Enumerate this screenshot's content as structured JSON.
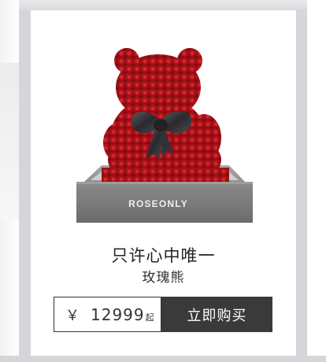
{
  "product": {
    "name": "只许心中唯一",
    "subtitle": "玫瑰熊",
    "box_brand": "ROSEONLY",
    "image_icon": "rose-bear-image"
  },
  "price": {
    "currency": "￥",
    "amount": "12999",
    "suffix": "起"
  },
  "buy_button": {
    "label": "立即购买"
  },
  "colors": {
    "button_bg": "#3a3a3a",
    "rose_red": "#c4161c",
    "box_grey": "#7a7a7a"
  }
}
